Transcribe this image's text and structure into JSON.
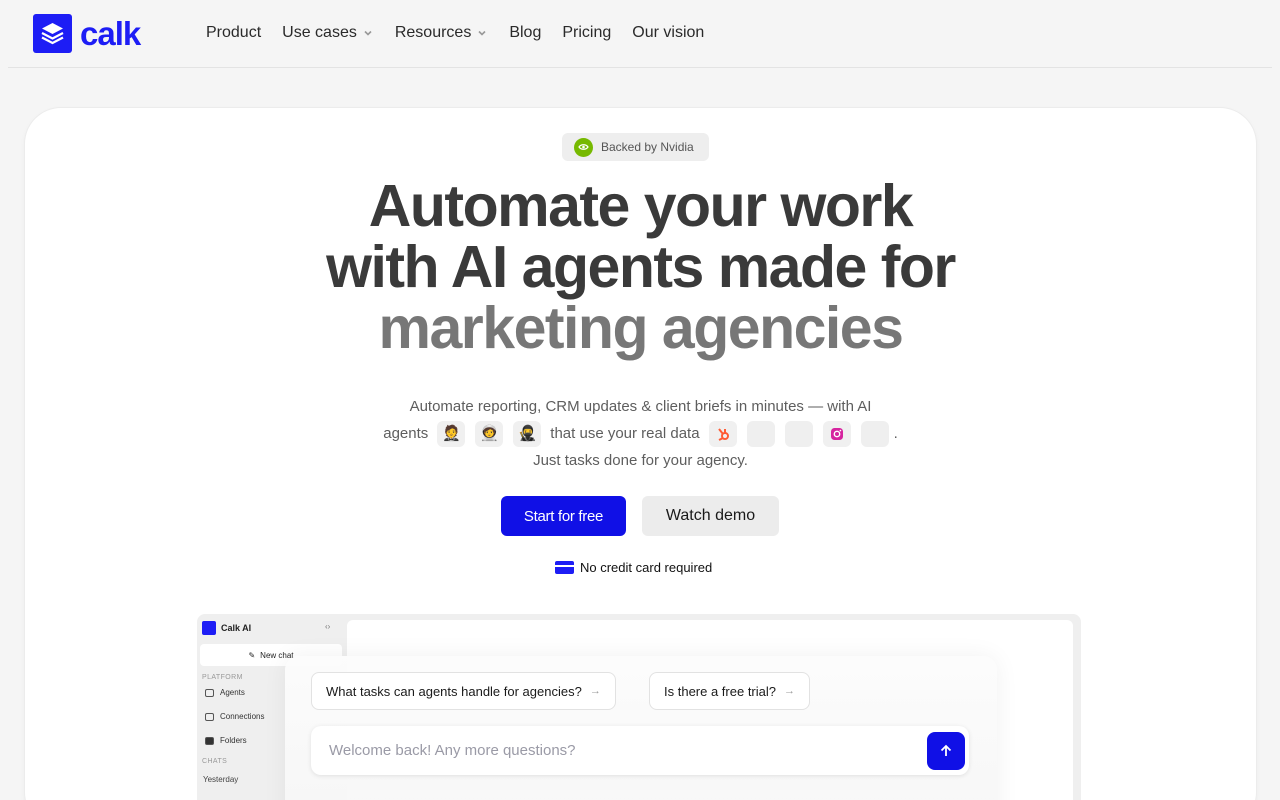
{
  "nav": {
    "brand": "calk",
    "items": [
      {
        "label": "Product",
        "dropdown": false
      },
      {
        "label": "Use cases",
        "dropdown": true
      },
      {
        "label": "Resources",
        "dropdown": true
      },
      {
        "label": "Blog",
        "dropdown": false
      },
      {
        "label": "Pricing",
        "dropdown": false
      },
      {
        "label": "Our vision",
        "dropdown": false
      }
    ]
  },
  "hero": {
    "badge": "Backed by Nvidia",
    "headline_line1": "Automate your work",
    "headline_line2": "with AI agents made for",
    "headline_line3": "marketing agencies",
    "sub_line1": "Automate reporting, CRM updates & client briefs in minutes — with AI",
    "sub_agents": "agents",
    "sub_mid": "that use your real data",
    "sub_period": ".",
    "sub_line3": "Just tasks done for your agency.",
    "agent_icons": [
      "agent-avatar-1-icon",
      "agent-avatar-2-icon",
      "agent-avatar-3-icon"
    ],
    "tool_icons": [
      "hubspot-icon",
      "tool-2-icon",
      "tool-3-icon",
      "instagram-icon",
      "tool-5-icon"
    ],
    "cta_primary": "Start for free",
    "cta_secondary": "Watch demo",
    "no_card": "No credit card required"
  },
  "preview": {
    "brand": "Calk AI",
    "new_chat": "New chat",
    "platform_label": "PLATFORM",
    "platform_items": [
      "Agents",
      "Connections",
      "Folders"
    ],
    "chats_label": "CHATS",
    "yesterday": "Yesterday",
    "suggestions": [
      "What tasks can agents handle for agencies?",
      "Is there a free trial?"
    ],
    "input_placeholder": "Welcome back! Any more questions?"
  },
  "colors": {
    "brand": "#1d1df5",
    "cta": "#1010e6",
    "nvidia": "#76b900"
  }
}
